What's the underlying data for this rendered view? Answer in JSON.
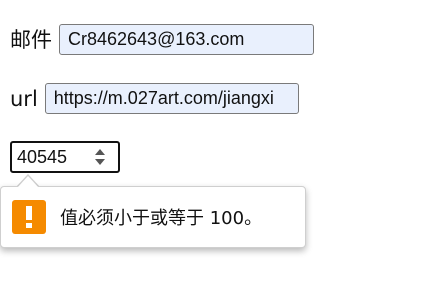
{
  "form": {
    "email": {
      "label": "邮件",
      "value": "Cr8462643@163.com"
    },
    "url": {
      "label": "url",
      "value": "https://m.027art.com/jiangxi"
    },
    "number": {
      "value": "40545"
    }
  },
  "validation_tooltip": {
    "icon": "warning-icon",
    "icon_color": "#f58a00",
    "message": "值必须小于或等于 100。"
  }
}
